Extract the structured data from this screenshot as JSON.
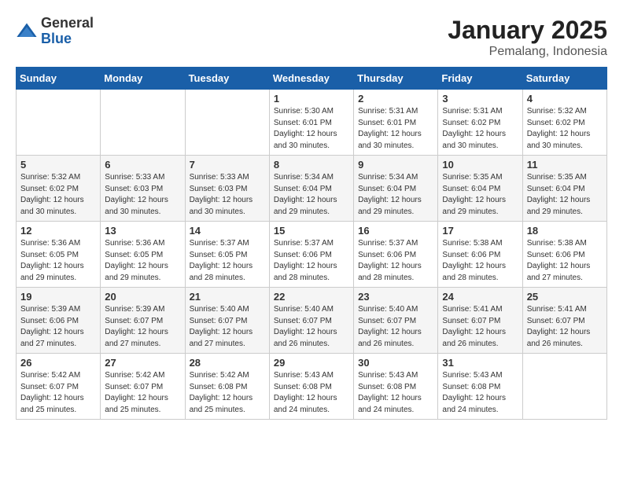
{
  "logo": {
    "general": "General",
    "blue": "Blue"
  },
  "title": "January 2025",
  "subtitle": "Pemalang, Indonesia",
  "weekdays": [
    "Sunday",
    "Monday",
    "Tuesday",
    "Wednesday",
    "Thursday",
    "Friday",
    "Saturday"
  ],
  "weeks": [
    [
      {
        "day": null
      },
      {
        "day": null
      },
      {
        "day": null
      },
      {
        "day": "1",
        "sunrise": "5:30 AM",
        "sunset": "6:01 PM",
        "daylight": "12 hours and 30 minutes."
      },
      {
        "day": "2",
        "sunrise": "5:31 AM",
        "sunset": "6:01 PM",
        "daylight": "12 hours and 30 minutes."
      },
      {
        "day": "3",
        "sunrise": "5:31 AM",
        "sunset": "6:02 PM",
        "daylight": "12 hours and 30 minutes."
      },
      {
        "day": "4",
        "sunrise": "5:32 AM",
        "sunset": "6:02 PM",
        "daylight": "12 hours and 30 minutes."
      }
    ],
    [
      {
        "day": "5",
        "sunrise": "5:32 AM",
        "sunset": "6:02 PM",
        "daylight": "12 hours and 30 minutes."
      },
      {
        "day": "6",
        "sunrise": "5:33 AM",
        "sunset": "6:03 PM",
        "daylight": "12 hours and 30 minutes."
      },
      {
        "day": "7",
        "sunrise": "5:33 AM",
        "sunset": "6:03 PM",
        "daylight": "12 hours and 30 minutes."
      },
      {
        "day": "8",
        "sunrise": "5:34 AM",
        "sunset": "6:04 PM",
        "daylight": "12 hours and 29 minutes."
      },
      {
        "day": "9",
        "sunrise": "5:34 AM",
        "sunset": "6:04 PM",
        "daylight": "12 hours and 29 minutes."
      },
      {
        "day": "10",
        "sunrise": "5:35 AM",
        "sunset": "6:04 PM",
        "daylight": "12 hours and 29 minutes."
      },
      {
        "day": "11",
        "sunrise": "5:35 AM",
        "sunset": "6:04 PM",
        "daylight": "12 hours and 29 minutes."
      }
    ],
    [
      {
        "day": "12",
        "sunrise": "5:36 AM",
        "sunset": "6:05 PM",
        "daylight": "12 hours and 29 minutes."
      },
      {
        "day": "13",
        "sunrise": "5:36 AM",
        "sunset": "6:05 PM",
        "daylight": "12 hours and 29 minutes."
      },
      {
        "day": "14",
        "sunrise": "5:37 AM",
        "sunset": "6:05 PM",
        "daylight": "12 hours and 28 minutes."
      },
      {
        "day": "15",
        "sunrise": "5:37 AM",
        "sunset": "6:06 PM",
        "daylight": "12 hours and 28 minutes."
      },
      {
        "day": "16",
        "sunrise": "5:37 AM",
        "sunset": "6:06 PM",
        "daylight": "12 hours and 28 minutes."
      },
      {
        "day": "17",
        "sunrise": "5:38 AM",
        "sunset": "6:06 PM",
        "daylight": "12 hours and 28 minutes."
      },
      {
        "day": "18",
        "sunrise": "5:38 AM",
        "sunset": "6:06 PM",
        "daylight": "12 hours and 27 minutes."
      }
    ],
    [
      {
        "day": "19",
        "sunrise": "5:39 AM",
        "sunset": "6:06 PM",
        "daylight": "12 hours and 27 minutes."
      },
      {
        "day": "20",
        "sunrise": "5:39 AM",
        "sunset": "6:07 PM",
        "daylight": "12 hours and 27 minutes."
      },
      {
        "day": "21",
        "sunrise": "5:40 AM",
        "sunset": "6:07 PM",
        "daylight": "12 hours and 27 minutes."
      },
      {
        "day": "22",
        "sunrise": "5:40 AM",
        "sunset": "6:07 PM",
        "daylight": "12 hours and 26 minutes."
      },
      {
        "day": "23",
        "sunrise": "5:40 AM",
        "sunset": "6:07 PM",
        "daylight": "12 hours and 26 minutes."
      },
      {
        "day": "24",
        "sunrise": "5:41 AM",
        "sunset": "6:07 PM",
        "daylight": "12 hours and 26 minutes."
      },
      {
        "day": "25",
        "sunrise": "5:41 AM",
        "sunset": "6:07 PM",
        "daylight": "12 hours and 26 minutes."
      }
    ],
    [
      {
        "day": "26",
        "sunrise": "5:42 AM",
        "sunset": "6:07 PM",
        "daylight": "12 hours and 25 minutes."
      },
      {
        "day": "27",
        "sunrise": "5:42 AM",
        "sunset": "6:07 PM",
        "daylight": "12 hours and 25 minutes."
      },
      {
        "day": "28",
        "sunrise": "5:42 AM",
        "sunset": "6:08 PM",
        "daylight": "12 hours and 25 minutes."
      },
      {
        "day": "29",
        "sunrise": "5:43 AM",
        "sunset": "6:08 PM",
        "daylight": "12 hours and 24 minutes."
      },
      {
        "day": "30",
        "sunrise": "5:43 AM",
        "sunset": "6:08 PM",
        "daylight": "12 hours and 24 minutes."
      },
      {
        "day": "31",
        "sunrise": "5:43 AM",
        "sunset": "6:08 PM",
        "daylight": "12 hours and 24 minutes."
      },
      {
        "day": null
      }
    ]
  ],
  "labels": {
    "sunrise": "Sunrise:",
    "sunset": "Sunset:",
    "daylight": "Daylight:"
  }
}
